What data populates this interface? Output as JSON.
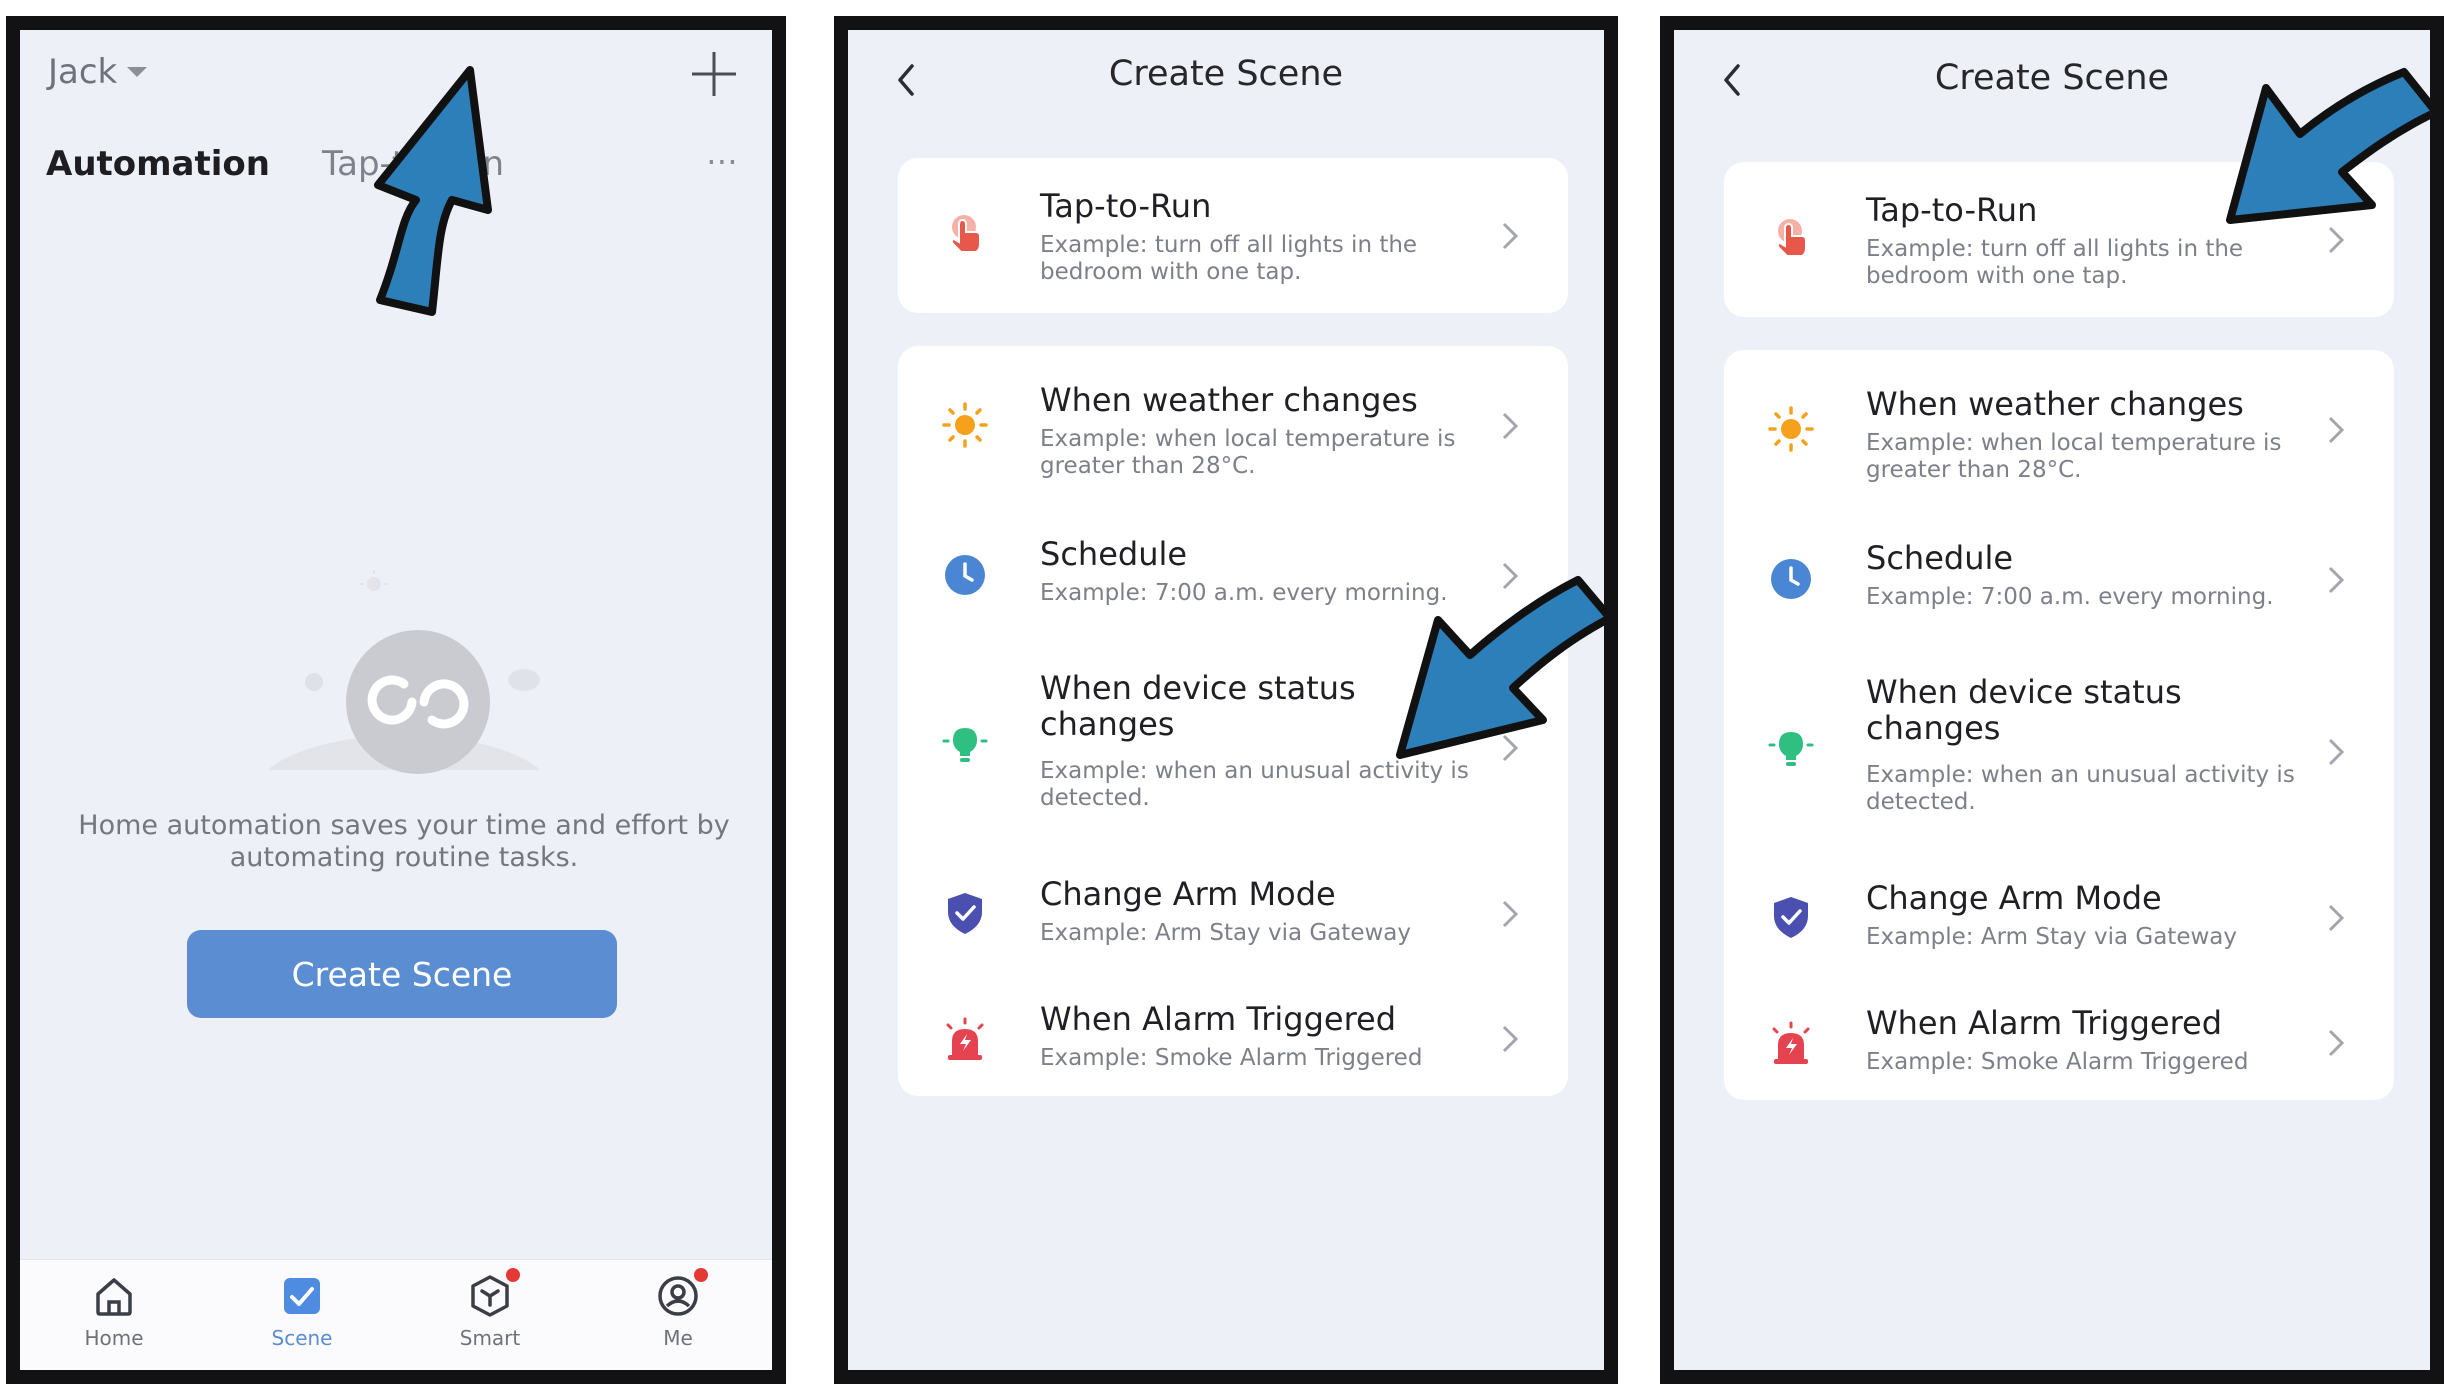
{
  "panel1": {
    "user": "Jack",
    "tabs": [
      "Automation",
      "Tap-to-Run"
    ],
    "more": "⋯",
    "empty_text": "Home automation saves your time and effort by automating routine tasks.",
    "create_button": "Create Scene",
    "nav": [
      {
        "label": "Home",
        "icon": "home-icon"
      },
      {
        "label": "Scene",
        "icon": "scene-check-icon",
        "active": true
      },
      {
        "label": "Smart",
        "icon": "smart-cube-icon",
        "badge": true
      },
      {
        "label": "Me",
        "icon": "profile-icon",
        "badge": true
      }
    ],
    "colors": {
      "accent": "#5b8dd3",
      "background": "#eef0f7",
      "badge": "#e53935"
    }
  },
  "create_scene": {
    "title": "Create Scene",
    "items": [
      {
        "title": "Tap-to-Run",
        "desc": "Example: turn off all lights in the bedroom with one tap.",
        "icon": "tap-hand-icon",
        "color": "#e8584a"
      },
      {
        "title": "When weather changes",
        "desc": "Example: when local temperature is greater than 28°C.",
        "icon": "sun-icon",
        "color": "#f6a11c"
      },
      {
        "title": "Schedule",
        "desc": "Example: 7:00 a.m. every morning.",
        "icon": "clock-icon",
        "color": "#4a86d4"
      },
      {
        "title": "When device status changes",
        "desc": "Example: when an unusual activity is detected.",
        "icon": "bulb-icon",
        "color": "#2fbf80"
      },
      {
        "title": "Change Arm Mode",
        "desc": "Example: Arm Stay via Gateway",
        "icon": "shield-check-icon",
        "color": "#4b4fb0"
      },
      {
        "title": "When Alarm Triggered",
        "desc": "Example: Smoke Alarm Triggered",
        "icon": "alarm-siren-icon",
        "color": "#e5434f"
      }
    ]
  },
  "annotations": {
    "arrow_color": "#2c7fb8"
  }
}
